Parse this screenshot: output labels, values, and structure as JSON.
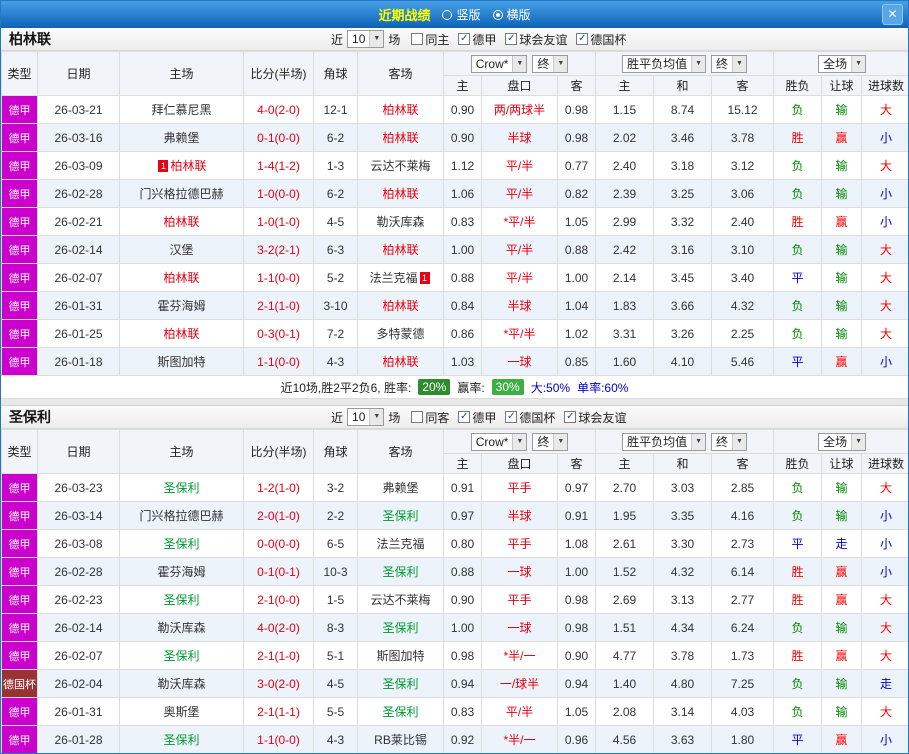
{
  "titlebar": {
    "title": "近期战绩",
    "radios": [
      {
        "label": "竖版",
        "checked": false
      },
      {
        "label": "横版",
        "checked": true
      }
    ]
  },
  "icons": {
    "chevron_down": "▼",
    "close": "✕",
    "check": "✓"
  },
  "colors": {
    "titlebar_blue": "#0d62b6",
    "title_yellow": "#ffff00",
    "league_badge_bg": "#cc00cc",
    "cup_badge_bg": "#993333",
    "focus_team_section1": "#e60012",
    "focus_team_section2": "#009933",
    "win_red": "#ff0000",
    "draw_blue": "#0000cc",
    "lose_green": "#008800",
    "score_red": "#e60012",
    "rate_badge_green_dark": "#2e8b2e",
    "rate_badge_green": "#3cb043",
    "row_alt_bg": "#edf3fa"
  },
  "result_color_class": {
    "胜": "r",
    "赢": "r",
    "大": "r",
    "平": "b",
    "走": "b",
    "小": "b",
    "负": "g",
    "输": "g"
  },
  "columns": {
    "type": "类型",
    "date": "日期",
    "home": "主场",
    "score": "比分(半场)",
    "corner": "角球",
    "away": "客场",
    "asian_home": "主",
    "asian_line": "盘口",
    "asian_away": "客",
    "euro_home": "主",
    "euro_draw": "和",
    "euro_away": "客",
    "result": "胜负",
    "handicap_result": "让球",
    "goals": "进球数"
  },
  "sections": [
    {
      "team": "柏林联",
      "near_label": "近",
      "games_count": "10",
      "games_suffix": "场",
      "checkboxes": [
        {
          "label": "同主",
          "checked": false
        },
        {
          "label": "德甲",
          "checked": true
        },
        {
          "label": "球会友谊",
          "checked": true
        },
        {
          "label": "德国杯",
          "checked": true
        }
      ],
      "filters": {
        "bookmaker": "Crow*",
        "final_a": "终",
        "avg": "胜平负均值",
        "final_b": "终",
        "scope": "全场"
      },
      "rows": [
        {
          "league": "德甲",
          "cup": false,
          "date": "26-03-21",
          "home": "拜仁慕尼黑",
          "home_focus": false,
          "home_badge": "",
          "score": "4-0(2-0)",
          "corner": "12-1",
          "away": "柏林联",
          "away_focus": true,
          "away_badge": "",
          "ah": "0.90",
          "line": "两/两球半",
          "aa": "0.98",
          "eh": "1.15",
          "ed": "8.74",
          "ea": "15.12",
          "res": "负",
          "hres": "输",
          "goals": "大"
        },
        {
          "league": "德甲",
          "cup": false,
          "date": "26-03-16",
          "home": "弗赖堡",
          "home_focus": false,
          "home_badge": "",
          "score": "0-1(0-0)",
          "corner": "6-2",
          "away": "柏林联",
          "away_focus": true,
          "away_badge": "",
          "ah": "0.90",
          "line": "半球",
          "aa": "0.98",
          "eh": "2.02",
          "ed": "3.46",
          "ea": "3.78",
          "res": "胜",
          "hres": "赢",
          "goals": "小"
        },
        {
          "league": "德甲",
          "cup": false,
          "date": "26-03-09",
          "home": "柏林联",
          "home_focus": true,
          "home_badge": "1",
          "score": "1-4(1-2)",
          "corner": "1-3",
          "away": "云达不莱梅",
          "away_focus": false,
          "away_badge": "",
          "ah": "1.12",
          "line": "平/半",
          "aa": "0.77",
          "eh": "2.40",
          "ed": "3.18",
          "ea": "3.12",
          "res": "负",
          "hres": "输",
          "goals": "大"
        },
        {
          "league": "德甲",
          "cup": false,
          "date": "26-02-28",
          "home": "门兴格拉德巴赫",
          "home_focus": false,
          "home_badge": "",
          "score": "1-0(0-0)",
          "corner": "6-2",
          "away": "柏林联",
          "away_focus": true,
          "away_badge": "",
          "ah": "1.06",
          "line": "平/半",
          "aa": "0.82",
          "eh": "2.39",
          "ed": "3.25",
          "ea": "3.06",
          "res": "负",
          "hres": "输",
          "goals": "小"
        },
        {
          "league": "德甲",
          "cup": false,
          "date": "26-02-21",
          "home": "柏林联",
          "home_focus": true,
          "home_badge": "",
          "score": "1-0(1-0)",
          "corner": "4-5",
          "away": "勒沃库森",
          "away_focus": false,
          "away_badge": "",
          "ah": "0.83",
          "line": "*平/半",
          "aa": "1.05",
          "eh": "2.99",
          "ed": "3.32",
          "ea": "2.40",
          "res": "胜",
          "hres": "赢",
          "goals": "小"
        },
        {
          "league": "德甲",
          "cup": false,
          "date": "26-02-14",
          "home": "汉堡",
          "home_focus": false,
          "home_badge": "",
          "score": "3-2(2-1)",
          "corner": "6-3",
          "away": "柏林联",
          "away_focus": true,
          "away_badge": "",
          "ah": "1.00",
          "line": "平/半",
          "aa": "0.88",
          "eh": "2.42",
          "ed": "3.16",
          "ea": "3.10",
          "res": "负",
          "hres": "输",
          "goals": "大"
        },
        {
          "league": "德甲",
          "cup": false,
          "date": "26-02-07",
          "home": "柏林联",
          "home_focus": true,
          "home_badge": "",
          "score": "1-1(0-0)",
          "corner": "5-2",
          "away": "法兰克福",
          "away_focus": false,
          "away_badge": "1",
          "ah": "0.88",
          "line": "平/半",
          "aa": "1.00",
          "eh": "2.14",
          "ed": "3.45",
          "ea": "3.40",
          "res": "平",
          "hres": "输",
          "goals": "大"
        },
        {
          "league": "德甲",
          "cup": false,
          "date": "26-01-31",
          "home": "霍芬海姆",
          "home_focus": false,
          "home_badge": "",
          "score": "2-1(1-0)",
          "corner": "3-10",
          "away": "柏林联",
          "away_focus": true,
          "away_badge": "",
          "ah": "0.84",
          "line": "半球",
          "aa": "1.04",
          "eh": "1.83",
          "ed": "3.66",
          "ea": "4.32",
          "res": "负",
          "hres": "输",
          "goals": "大"
        },
        {
          "league": "德甲",
          "cup": false,
          "date": "26-01-25",
          "home": "柏林联",
          "home_focus": true,
          "home_badge": "",
          "score": "0-3(0-1)",
          "corner": "7-2",
          "away": "多特蒙德",
          "away_focus": false,
          "away_badge": "",
          "ah": "0.86",
          "line": "*平/半",
          "aa": "1.02",
          "eh": "3.31",
          "ed": "3.26",
          "ea": "2.25",
          "res": "负",
          "hres": "输",
          "goals": "大"
        },
        {
          "league": "德甲",
          "cup": false,
          "date": "26-01-18",
          "home": "斯图加特",
          "home_focus": false,
          "home_badge": "",
          "score": "1-1(0-0)",
          "corner": "4-3",
          "away": "柏林联",
          "away_focus": true,
          "away_badge": "",
          "ah": "1.03",
          "line": "一球",
          "aa": "0.85",
          "eh": "1.60",
          "ed": "4.10",
          "ea": "5.46",
          "res": "平",
          "hres": "赢",
          "goals": "小"
        }
      ],
      "summary": {
        "prefix": "近10场,胜2平2负6, 胜率:",
        "win_rate": "20%",
        "handicap_label": "赢率:",
        "handicap_rate": "30%",
        "big_rate": "大:50%",
        "odd_rate": "单率:60%"
      }
    },
    {
      "team": "圣保利",
      "near_label": "近",
      "games_count": "10",
      "games_suffix": "场",
      "checkboxes": [
        {
          "label": "同客",
          "checked": false
        },
        {
          "label": "德甲",
          "checked": true
        },
        {
          "label": "德国杯",
          "checked": true
        },
        {
          "label": "球会友谊",
          "checked": true
        }
      ],
      "filters": {
        "bookmaker": "Crow*",
        "final_a": "终",
        "avg": "胜平负均值",
        "final_b": "终",
        "scope": "全场"
      },
      "rows": [
        {
          "league": "德甲",
          "cup": false,
          "date": "26-03-23",
          "home": "圣保利",
          "home_focus": true,
          "home_badge": "",
          "score": "1-2(1-0)",
          "corner": "3-2",
          "away": "弗赖堡",
          "away_focus": false,
          "away_badge": "",
          "ah": "0.91",
          "line": "平手",
          "aa": "0.97",
          "eh": "2.70",
          "ed": "3.03",
          "ea": "2.85",
          "res": "负",
          "hres": "输",
          "goals": "大"
        },
        {
          "league": "德甲",
          "cup": false,
          "date": "26-03-14",
          "home": "门兴格拉德巴赫",
          "home_focus": false,
          "home_badge": "",
          "score": "2-0(1-0)",
          "corner": "2-2",
          "away": "圣保利",
          "away_focus": true,
          "away_badge": "",
          "ah": "0.97",
          "line": "半球",
          "aa": "0.91",
          "eh": "1.95",
          "ed": "3.35",
          "ea": "4.16",
          "res": "负",
          "hres": "输",
          "goals": "小"
        },
        {
          "league": "德甲",
          "cup": false,
          "date": "26-03-08",
          "home": "圣保利",
          "home_focus": true,
          "home_badge": "",
          "score": "0-0(0-0)",
          "corner": "6-5",
          "away": "法兰克福",
          "away_focus": false,
          "away_badge": "",
          "ah": "0.80",
          "line": "平手",
          "aa": "1.08",
          "eh": "2.61",
          "ed": "3.30",
          "ea": "2.73",
          "res": "平",
          "hres": "走",
          "goals": "小"
        },
        {
          "league": "德甲",
          "cup": false,
          "date": "26-02-28",
          "home": "霍芬海姆",
          "home_focus": false,
          "home_badge": "",
          "score": "0-1(0-1)",
          "corner": "10-3",
          "away": "圣保利",
          "away_focus": true,
          "away_badge": "",
          "ah": "0.88",
          "line": "一球",
          "aa": "1.00",
          "eh": "1.52",
          "ed": "4.32",
          "ea": "6.14",
          "res": "胜",
          "hres": "赢",
          "goals": "小"
        },
        {
          "league": "德甲",
          "cup": false,
          "date": "26-02-23",
          "home": "圣保利",
          "home_focus": true,
          "home_badge": "",
          "score": "2-1(0-0)",
          "corner": "1-5",
          "away": "云达不莱梅",
          "away_focus": false,
          "away_badge": "",
          "ah": "0.90",
          "line": "平手",
          "aa": "0.98",
          "eh": "2.69",
          "ed": "3.13",
          "ea": "2.77",
          "res": "胜",
          "hres": "赢",
          "goals": "大"
        },
        {
          "league": "德甲",
          "cup": false,
          "date": "26-02-14",
          "home": "勒沃库森",
          "home_focus": false,
          "home_badge": "",
          "score": "4-0(2-0)",
          "corner": "8-3",
          "away": "圣保利",
          "away_focus": true,
          "away_badge": "",
          "ah": "1.00",
          "line": "一球",
          "aa": "0.98",
          "eh": "1.51",
          "ed": "4.34",
          "ea": "6.24",
          "res": "负",
          "hres": "输",
          "goals": "大"
        },
        {
          "league": "德甲",
          "cup": false,
          "date": "26-02-07",
          "home": "圣保利",
          "home_focus": true,
          "home_badge": "",
          "score": "2-1(1-0)",
          "corner": "5-1",
          "away": "斯图加特",
          "away_focus": false,
          "away_badge": "",
          "ah": "0.98",
          "line": "*半/一",
          "aa": "0.90",
          "eh": "4.77",
          "ed": "3.78",
          "ea": "1.73",
          "res": "胜",
          "hres": "赢",
          "goals": "大"
        },
        {
          "league": "德国杯",
          "cup": true,
          "date": "26-02-04",
          "home": "勒沃库森",
          "home_focus": false,
          "home_badge": "",
          "score": "3-0(2-0)",
          "corner": "4-5",
          "away": "圣保利",
          "away_focus": true,
          "away_badge": "",
          "ah": "0.94",
          "line": "一/球半",
          "aa": "0.94",
          "eh": "1.40",
          "ed": "4.80",
          "ea": "7.25",
          "res": "负",
          "hres": "输",
          "goals": "走"
        },
        {
          "league": "德甲",
          "cup": false,
          "date": "26-01-31",
          "home": "奥斯堡",
          "home_focus": false,
          "home_badge": "",
          "score": "2-1(1-1)",
          "corner": "5-5",
          "away": "圣保利",
          "away_focus": true,
          "away_badge": "",
          "ah": "0.83",
          "line": "平/半",
          "aa": "1.05",
          "eh": "2.08",
          "ed": "3.14",
          "ea": "4.03",
          "res": "负",
          "hres": "输",
          "goals": "大"
        },
        {
          "league": "德甲",
          "cup": false,
          "date": "26-01-28",
          "home": "圣保利",
          "home_focus": true,
          "home_badge": "",
          "score": "1-1(0-0)",
          "corner": "4-3",
          "away": "RB莱比锡",
          "away_focus": false,
          "away_badge": "",
          "ah": "0.92",
          "line": "*半/一",
          "aa": "0.96",
          "eh": "4.56",
          "ed": "3.63",
          "ea": "1.80",
          "res": "平",
          "hres": "赢",
          "goals": "小"
        }
      ]
    }
  ]
}
